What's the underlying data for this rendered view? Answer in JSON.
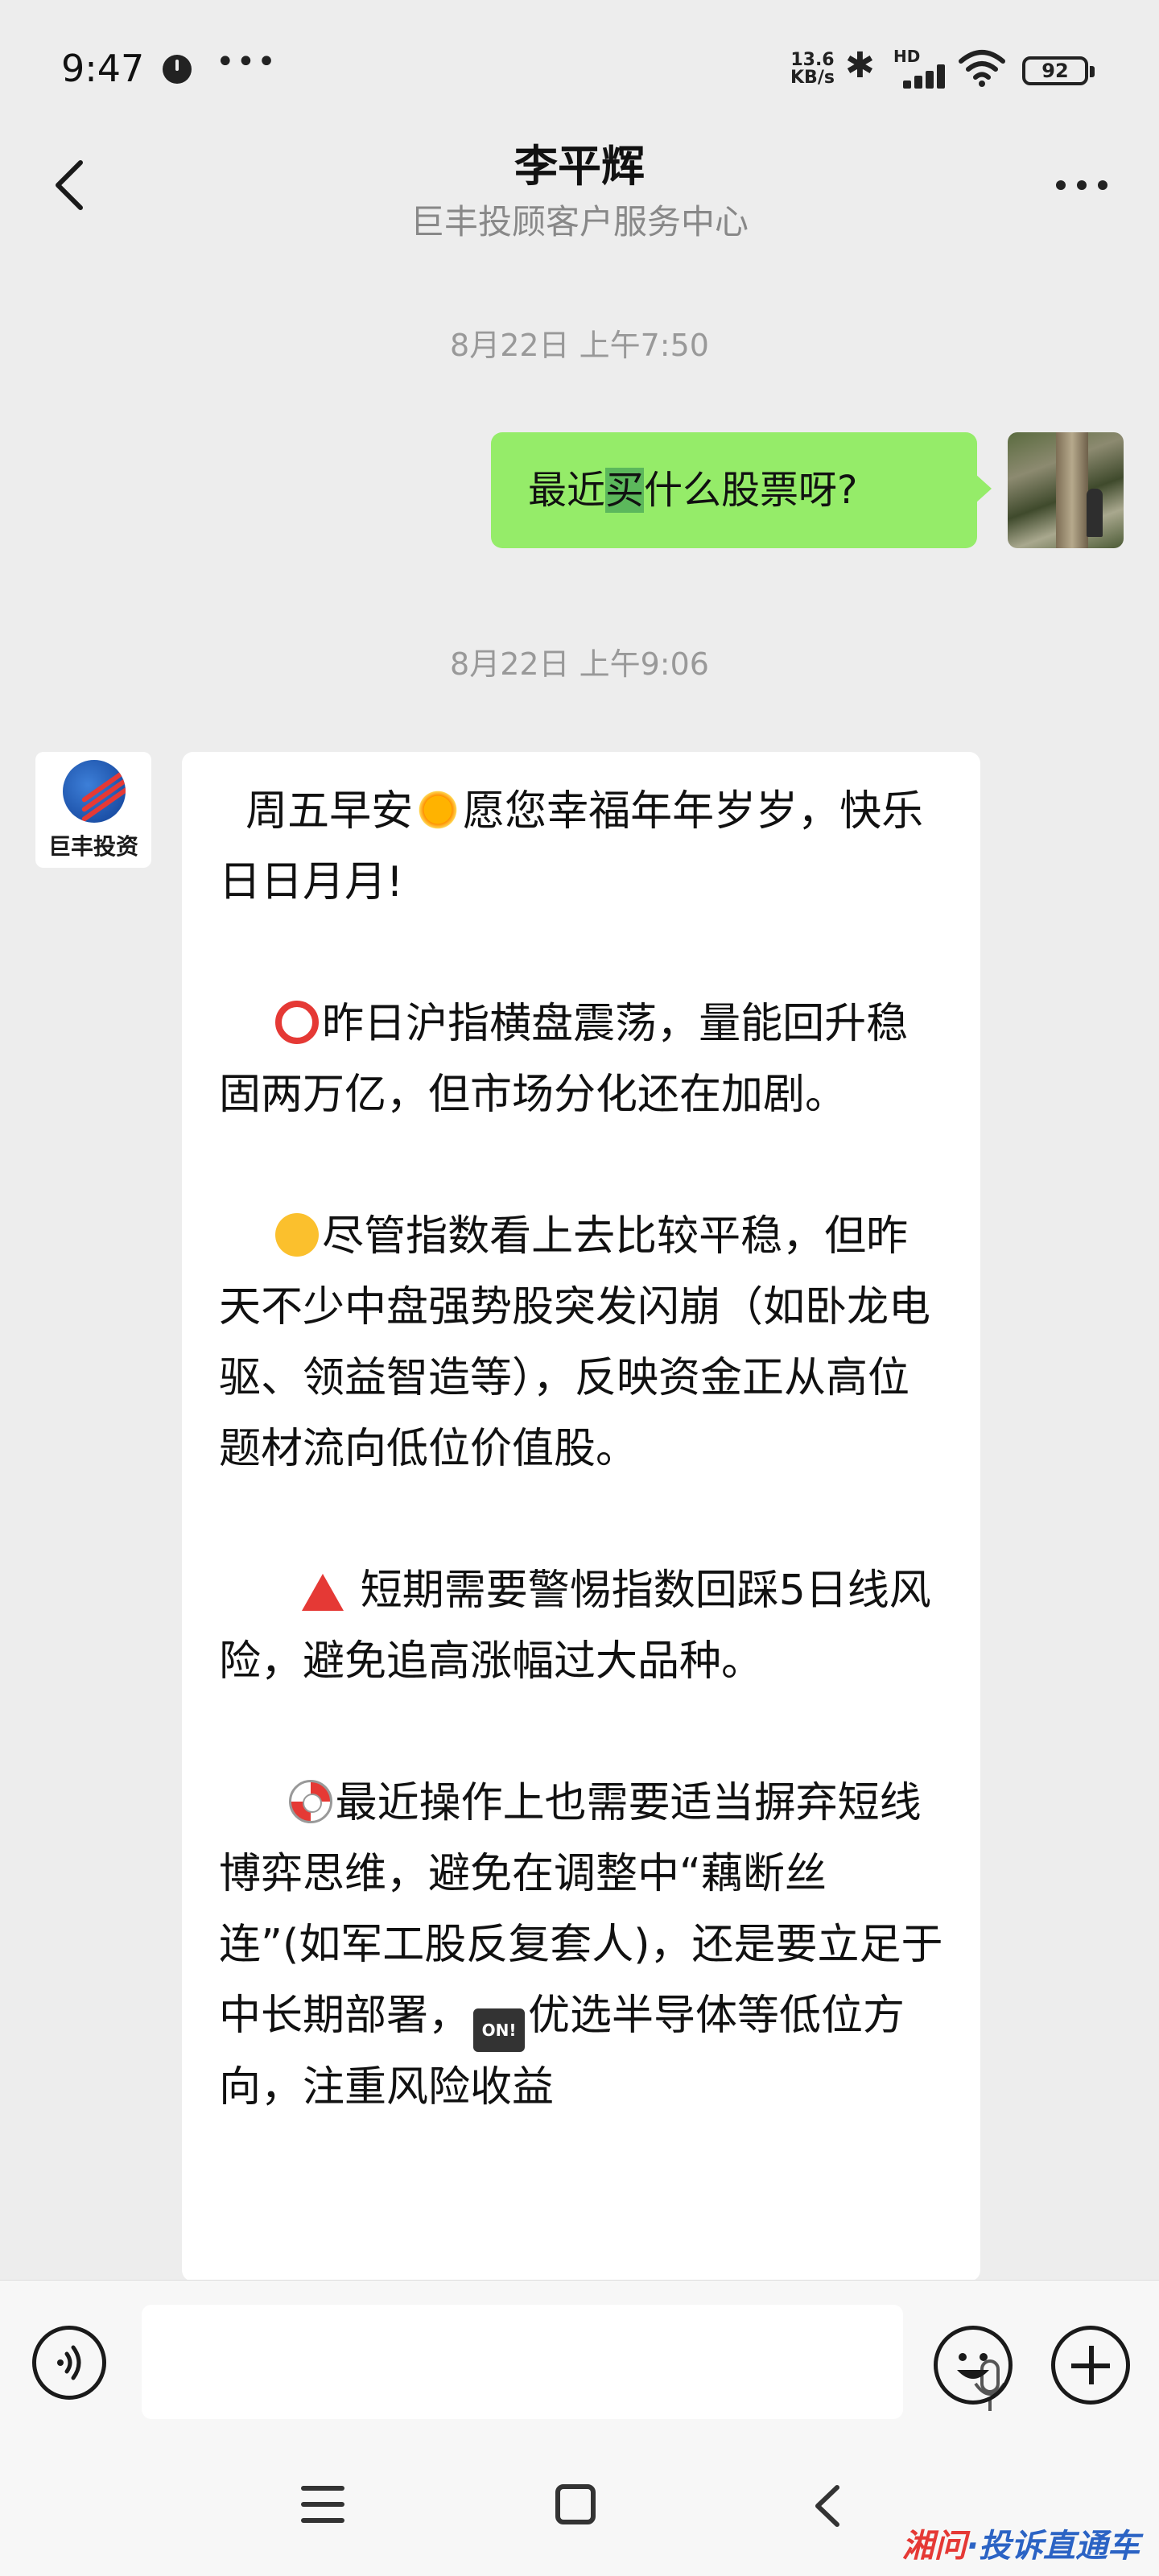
{
  "status_bar": {
    "time": "9:47",
    "network_speed": "13.6\nKB/s",
    "signal_label": "HD",
    "battery": "92"
  },
  "header": {
    "title": "李平辉",
    "subtitle": "巨丰投顾客户服务中心"
  },
  "messages": [
    {
      "timestamp": "8月22日 上午7:50",
      "direction": "outgoing",
      "text_before": "最近",
      "text_highlight": "买",
      "text_after": "什么股票呀?"
    },
    {
      "timestamp": "8月22日 上午9:06",
      "direction": "incoming",
      "sender_avatar_label": "巨丰投资",
      "paragraphs": {
        "p1_a": "周五早安",
        "p1_b": "愿您幸福年年岁岁，快乐日日月月!",
        "p2": "昨日沪指横盘震荡，量能回升稳固两万亿，但市场分化还在加剧。",
        "p3": "尽管指数看上去比较平稳，但昨天不少中盘强势股突发闪崩（如卧龙电驱、领益智造等），反映资金正从高位题材流向低位价值股。",
        "p4": "短期需要警惕指数回踩5日线风险，避免追高涨幅过大品种。",
        "p5_a": "最近操作上也需要适当摒弃短线博弈思维，避免在调整中“藕断丝连”(如军工股反复套人)，还是要立足于中长期部署，",
        "p5_b": "优选半导体等低位方向，注重风险收益"
      }
    }
  ],
  "icons": {
    "emoji_sun": "sun-with-face-icon",
    "emoji_circle": "red-circle-icon",
    "emoji_thinking": "thinking-face-icon",
    "emoji_triangle": "red-triangle-icon",
    "emoji_buoy": "ring-buoy-icon",
    "emoji_on": "on-arrow-icon",
    "on_label": "ON!"
  },
  "watermark": {
    "part1": "湘问",
    "part2": "·投诉直通车"
  },
  "colors": {
    "outgoing_bubble": "#95ec69",
    "background": "#ededed"
  }
}
